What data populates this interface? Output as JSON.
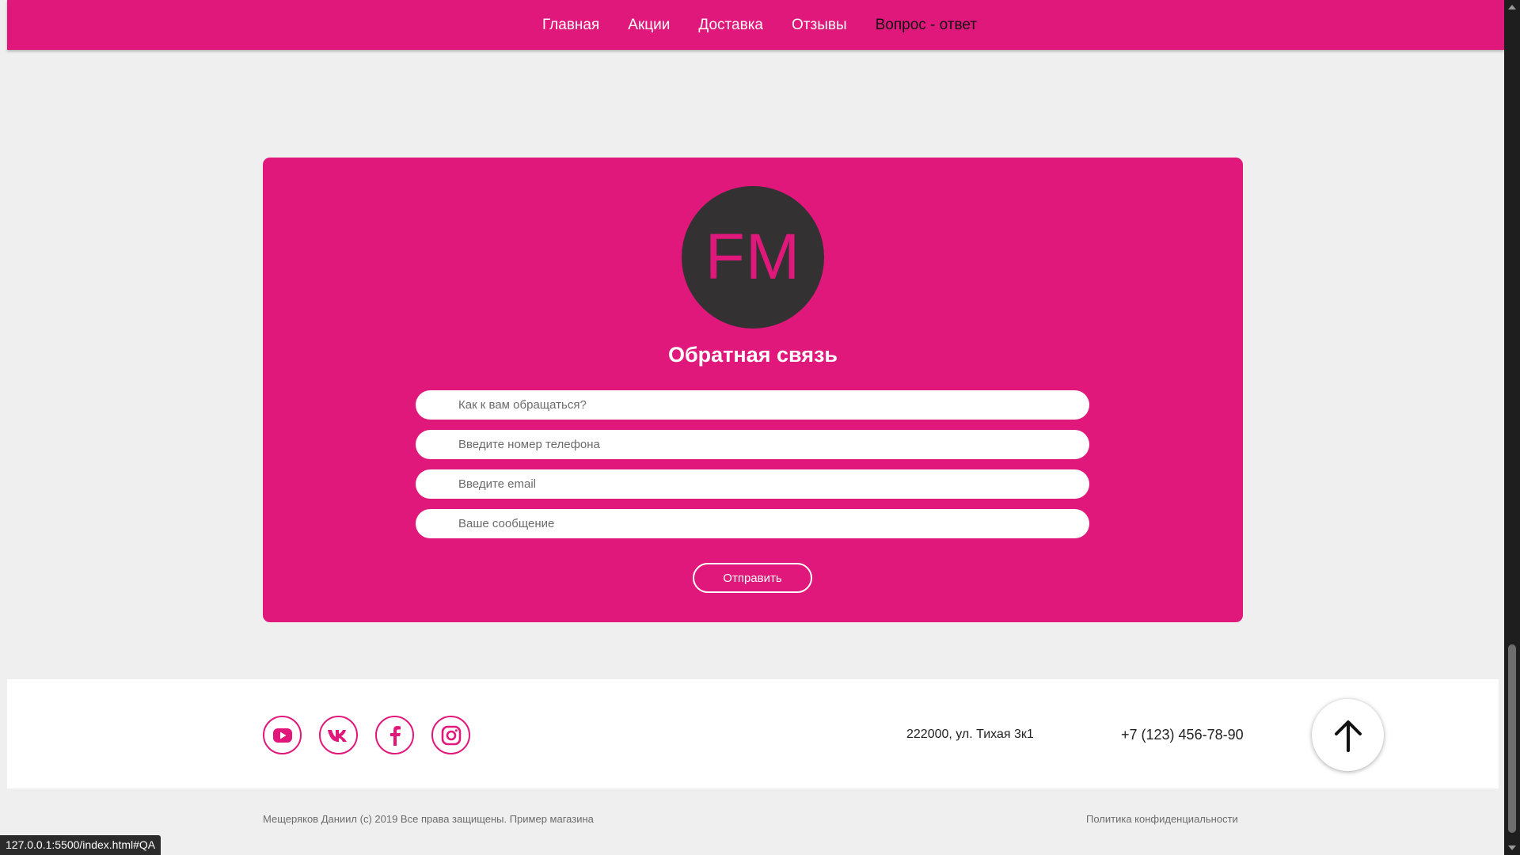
{
  "nav": {
    "items": [
      {
        "label": "Главная"
      },
      {
        "label": "Акции"
      },
      {
        "label": "Доставка"
      },
      {
        "label": "Отзывы"
      },
      {
        "label": "Вопрос - ответ"
      }
    ],
    "active_index": 4
  },
  "feedback": {
    "logo_text": "FM",
    "title": "Обратная связь",
    "name_placeholder": "Как к вам обращаться?",
    "phone_placeholder": "Введите номер телефона",
    "email_placeholder": "Введите email",
    "message_placeholder": "Ваше сообщение",
    "submit_label": "Отправить"
  },
  "footer": {
    "social": [
      "youtube-icon",
      "vk-icon",
      "facebook-icon",
      "instagram-icon"
    ],
    "address": "222000, ул. Тихая 3к1",
    "phone": "+7 (123) 456-78-90",
    "to_top_icon": "arrow-up-icon"
  },
  "bottom": {
    "copyright": "Мещеряков Даниил (c) 2019 Все права защищены. Пример магазина",
    "privacy": "Политика конфиденциальности"
  },
  "status_url": "127.0.0.1:5500/index.html#QA",
  "colors": {
    "brand": "#e1187b",
    "logo_bg": "#333132",
    "page_bg": "#f0efef"
  }
}
